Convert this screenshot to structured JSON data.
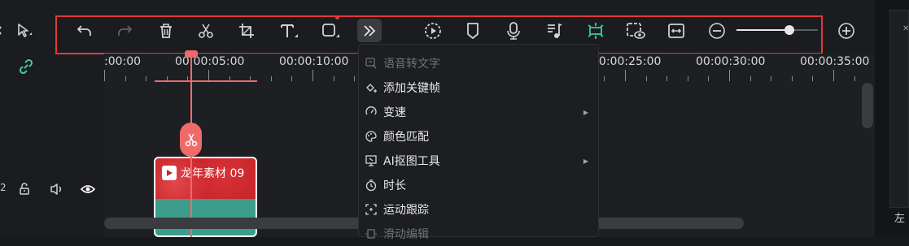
{
  "toolbar": {
    "icons": [
      "select-tool-icon",
      "undo-icon",
      "redo-icon",
      "delete-icon",
      "cut-icon",
      "crop-icon",
      "text-icon",
      "shape-icon",
      "more-icon",
      "speed-icon",
      "marker-icon",
      "mic-icon",
      "music-icon",
      "ai-icon",
      "preview-icon",
      "fit-icon",
      "zoom-out-icon",
      "zoom-in-icon"
    ],
    "zoom_level": 0.65
  },
  "ruler": {
    "labels": [
      ":00:00",
      "00:00:05:00",
      "00:00:10:00",
      "00:00:25:00",
      "00:00:30:00",
      "00:00:35:00"
    ]
  },
  "track": {
    "number": "2"
  },
  "clip": {
    "title": "龙年素材 09"
  },
  "context_menu": {
    "items": [
      {
        "label": "语音转文字",
        "icon": "speech-to-text-icon",
        "disabled": true,
        "submenu": false
      },
      {
        "label": "添加关键帧",
        "icon": "keyframe-icon",
        "disabled": false,
        "submenu": false
      },
      {
        "label": "变速",
        "icon": "speed-icon",
        "disabled": false,
        "submenu": true
      },
      {
        "label": "颜色匹配",
        "icon": "palette-icon",
        "disabled": false,
        "submenu": false
      },
      {
        "label": "AI抠图工具",
        "icon": "ai-cutout-icon",
        "disabled": false,
        "submenu": true
      },
      {
        "label": "时长",
        "icon": "timer-icon",
        "disabled": false,
        "submenu": false
      },
      {
        "label": "运动跟踪",
        "icon": "motion-track-icon",
        "disabled": false,
        "submenu": false
      },
      {
        "label": "滑动编辑",
        "icon": "slide-edit-icon",
        "disabled": true,
        "submenu": false
      }
    ]
  },
  "right_panel": {
    "corner_label": "左"
  },
  "colors": {
    "highlight_box": "#e23a3a",
    "playhead": "#f06a6a",
    "ai_icon": "#3ec7a5",
    "link_icon": "#3ec7a5"
  }
}
